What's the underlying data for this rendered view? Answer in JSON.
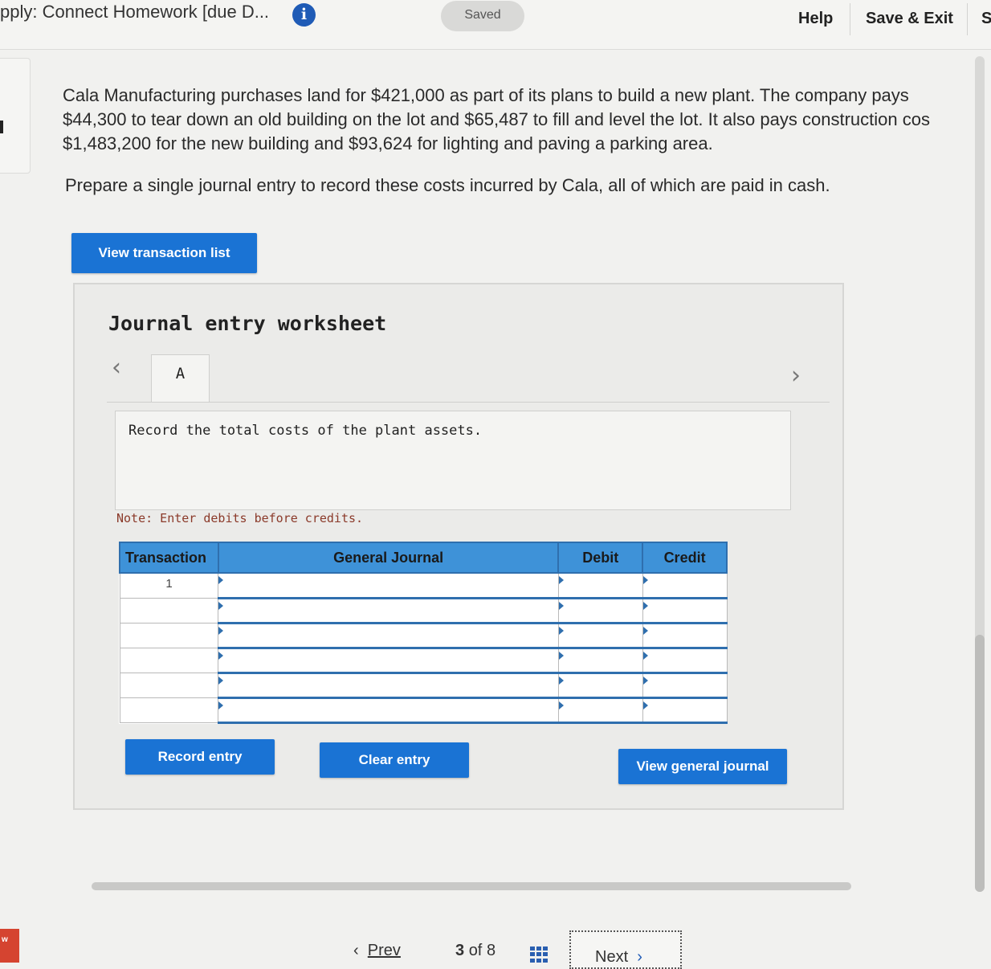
{
  "header": {
    "title": "pply: Connect Homework [due D...",
    "saved_label": "Saved",
    "help_label": "Help",
    "save_exit_label": "Save & Exit",
    "cut_label": "S"
  },
  "question": {
    "lines": [
      "Cala Manufacturing purchases land for $421,000 as part of its plans to build a new plant. The company pays",
      "$44,300 to tear down an old building on the lot and $65,487 to fill and level the lot. It also pays  construction cos",
      "$1,483,200 for the new building and $93,624 for lighting and paving a parking area."
    ],
    "prompt": "Prepare a single journal entry to record these costs incurred by Cala, all of which are paid in cash."
  },
  "buttons": {
    "view_transaction_list": "View transaction list",
    "record_entry": "Record entry",
    "clear_entry": "Clear entry",
    "view_general_journal": "View general journal"
  },
  "worksheet": {
    "title": "Journal entry worksheet",
    "tab_label": "A",
    "description": "Record the total costs of the plant assets.",
    "note": "Note: Enter debits before credits.",
    "table": {
      "headers": [
        "Transaction",
        "General Journal",
        "Debit",
        "Credit"
      ],
      "first_transaction": "1"
    }
  },
  "footer": {
    "prev_label": "Prev",
    "page_current": "3",
    "page_of": "of",
    "page_total": "8",
    "next_label": "Next"
  },
  "corner_badge": "w",
  "colors": {
    "accent": "#1a73d4",
    "table_header": "#3e92d8",
    "info_icon": "#1f5bb6"
  }
}
